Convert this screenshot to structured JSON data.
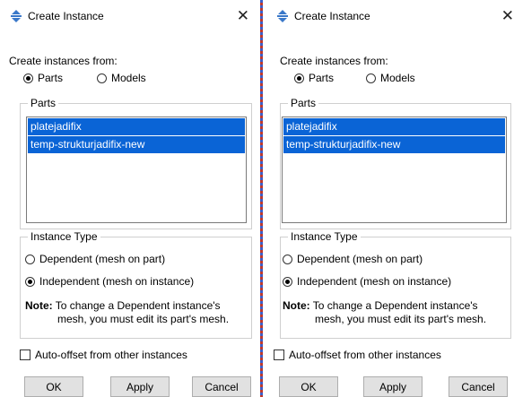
{
  "dialogs": [
    {
      "title": "Create Instance",
      "from_label": "Create instances from:",
      "source_options": [
        {
          "label": "Parts",
          "selected": true
        },
        {
          "label": "Models",
          "selected": false
        }
      ],
      "parts_legend": "Parts",
      "parts": [
        "platejadifix",
        "temp-strukturjadifix-new"
      ],
      "instance_type_legend": "Instance Type",
      "instance_type_options": [
        {
          "label": "Dependent (mesh on part)",
          "selected": false
        },
        {
          "label": "Independent (mesh on instance)",
          "selected": true
        }
      ],
      "note_label": "Note:",
      "note_line1": "To change a Dependent instance's",
      "note_line2": "mesh, you must edit its part's mesh.",
      "auto_offset_label": "Auto-offset from other instances",
      "auto_offset_checked": false,
      "buttons": {
        "ok": "OK",
        "apply": "Apply",
        "cancel": "Cancel"
      }
    },
    {
      "title": "Create Instance",
      "from_label": "Create instances from:",
      "source_options": [
        {
          "label": "Parts",
          "selected": true
        },
        {
          "label": "Models",
          "selected": false
        }
      ],
      "parts_legend": "Parts",
      "parts": [
        "platejadifix",
        "temp-strukturjadifix-new"
      ],
      "instance_type_legend": "Instance Type",
      "instance_type_options": [
        {
          "label": "Dependent (mesh on part)",
          "selected": false
        },
        {
          "label": "Independent (mesh on instance)",
          "selected": true
        }
      ],
      "note_label": "Note:",
      "note_line1": "To change a Dependent instance's",
      "note_line2": "mesh, you must edit its part's mesh.",
      "auto_offset_label": "Auto-offset from other instances",
      "auto_offset_checked": false,
      "buttons": {
        "ok": "OK",
        "apply": "Apply",
        "cancel": "Cancel"
      }
    }
  ],
  "colors": {
    "selection": "#0a64d6",
    "accent_icon": "#3a78c9"
  }
}
